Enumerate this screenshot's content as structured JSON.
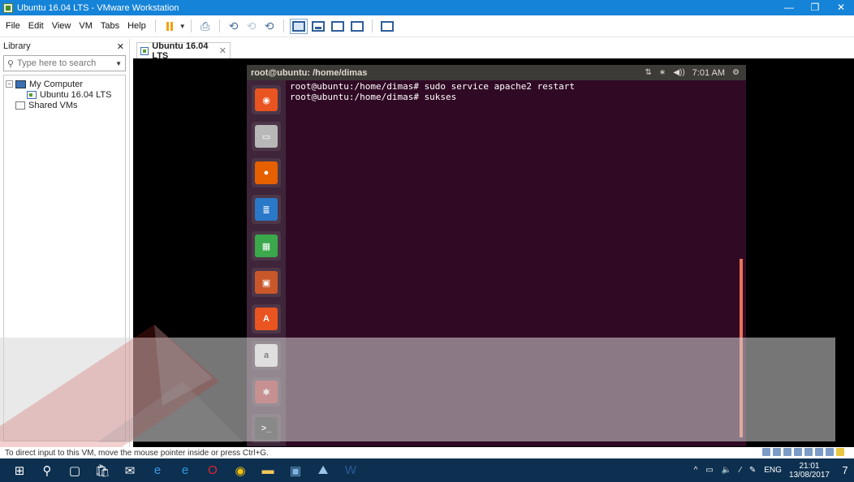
{
  "window": {
    "title": "Ubuntu 16.04 LTS - VMware Workstation",
    "controls": {
      "minimize": "—",
      "maximize": "❐",
      "close": "✕"
    }
  },
  "menu": [
    "File",
    "Edit",
    "View",
    "VM",
    "Tabs",
    "Help"
  ],
  "library": {
    "title": "Library",
    "close": "✕",
    "search_placeholder": "Type here to search",
    "tree": {
      "root": "My Computer",
      "vm": "Ubuntu 16.04 LTS",
      "shared": "Shared VMs"
    }
  },
  "tab": {
    "label": "Ubuntu 16.04 LTS",
    "close": "✕"
  },
  "guest": {
    "window_title": "root@ubuntu: /home/dimas",
    "indicators": {
      "network": "⇅",
      "bluetooth": "∗",
      "volume": "◀))",
      "time": "7:01 AM",
      "settings": "⚙"
    },
    "terminal_lines": [
      "root@ubuntu:/home/dimas# sudo service apache2 restart",
      "root@ubuntu:/home/dimas# sukses"
    ],
    "launcher": [
      {
        "name": "ubuntu-dash-icon",
        "glyph": "◉",
        "bg": "#e95420"
      },
      {
        "name": "files-icon",
        "glyph": "▭",
        "bg": "#b8b8b8"
      },
      {
        "name": "firefox-icon",
        "glyph": "●",
        "bg": "#e66000"
      },
      {
        "name": "writer-icon",
        "glyph": "≣",
        "bg": "#2a78c8"
      },
      {
        "name": "calc-icon",
        "glyph": "▦",
        "bg": "#3aa84b"
      },
      {
        "name": "impress-icon",
        "glyph": "▣",
        "bg": "#c9572a"
      },
      {
        "name": "software-center-icon",
        "glyph": "A",
        "bg": "#e95420"
      },
      {
        "name": "amazon-icon",
        "glyph": "a",
        "bg": "#e8e8e8"
      },
      {
        "name": "system-settings-icon",
        "glyph": "✱",
        "bg": "#b43c3c"
      },
      {
        "name": "terminal-icon",
        "glyph": ">_",
        "bg": "#2c2c2c"
      }
    ]
  },
  "statusbar": {
    "text": "To direct input to this VM, move the mouse pointer inside or press Ctrl+G."
  },
  "taskbar": {
    "apps": [
      {
        "name": "start-icon",
        "glyph": "⊞",
        "color": "#ffffff"
      },
      {
        "name": "search-icon",
        "glyph": "⚲",
        "color": "#ffffff"
      },
      {
        "name": "task-view-icon",
        "glyph": "▢",
        "color": "#ffffff"
      },
      {
        "name": "store-icon",
        "glyph": "🛍",
        "color": "#ffffff"
      },
      {
        "name": "mail-icon",
        "glyph": "✉",
        "color": "#ffffff"
      },
      {
        "name": "edge-icon",
        "glyph": "e",
        "color": "#3b9ae8"
      },
      {
        "name": "ie-icon",
        "glyph": "e",
        "color": "#2f9bdf"
      },
      {
        "name": "opera-icon",
        "glyph": "O",
        "color": "#e3252f"
      },
      {
        "name": "chrome-icon",
        "glyph": "◉",
        "color": "#f4c20d"
      },
      {
        "name": "file-explorer-icon",
        "glyph": "▬",
        "color": "#f1c75a"
      },
      {
        "name": "vmware-icon",
        "glyph": "▣",
        "color": "#7fb2e0"
      },
      {
        "name": "photos-icon",
        "glyph": "⛰",
        "color": "#9cc4e8"
      },
      {
        "name": "word-icon",
        "glyph": "W",
        "color": "#2b579a"
      }
    ],
    "tray": {
      "chevron": "^",
      "battery": "▭",
      "volume": "🔈",
      "wifi": "⁄",
      "pen": "✎",
      "lang": "ENG",
      "time": "21:01",
      "date": "13/08/2017",
      "notifications": "7"
    }
  }
}
